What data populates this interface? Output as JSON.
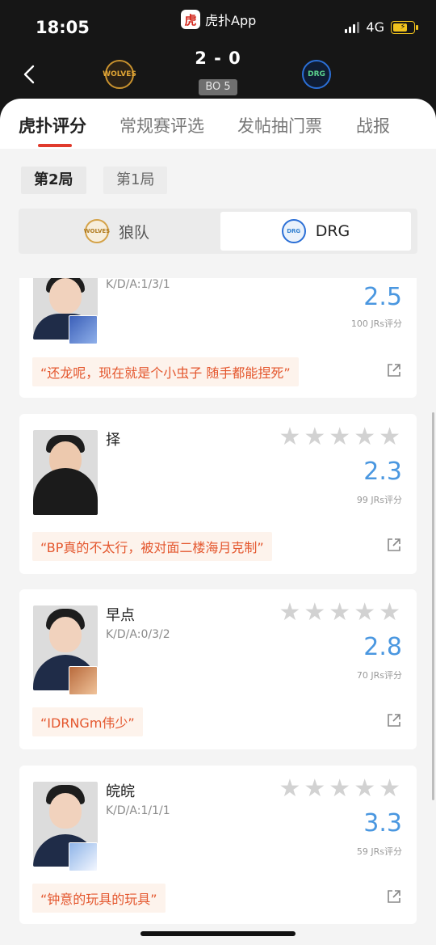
{
  "status": {
    "time": "18:05",
    "app": "虎扑App",
    "app_logo_char": "虎",
    "network": "4G"
  },
  "match": {
    "score": "2 - 0",
    "format": "BO 5",
    "team_a_short": "WOLVES",
    "team_b_short": "DRG"
  },
  "tabs": [
    {
      "label": "虎扑评分"
    },
    {
      "label": "常规赛评选"
    },
    {
      "label": "发帖抽门票"
    },
    {
      "label": "战报"
    }
  ],
  "rounds": [
    {
      "label": "第2局"
    },
    {
      "label": "第1局"
    }
  ],
  "teams": [
    {
      "label": "狼队",
      "logo_text": "WOLVES"
    },
    {
      "label": "DRG",
      "logo_text": "DRG"
    }
  ],
  "players": [
    {
      "name": "",
      "kda": "K/D/A:1/3/1",
      "score": "2.5",
      "votes": "100 JRs评分",
      "comment": "“还龙呢，现在就是个小虫子 随手都能捏死”",
      "hero_color": "#3b5fb8"
    },
    {
      "name": "择",
      "kda": "",
      "score": "2.3",
      "votes": "99 JRs评分",
      "comment": "“BP真的不太行，被对面二楼海月克制”",
      "hero_color": ""
    },
    {
      "name": "早点",
      "kda": "K/D/A:0/3/2",
      "score": "2.8",
      "votes": "70 JRs评分",
      "comment": "“IDRNGm伟少”",
      "hero_color": "#b86a3c"
    },
    {
      "name": "皖皖",
      "kda": "K/D/A:1/1/1",
      "score": "3.3",
      "votes": "59 JRs评分",
      "comment": "“钟意的玩具的玩具”",
      "hero_color": "#8fb4e8"
    }
  ],
  "colors": {
    "accent": "#e03a2c",
    "score_blue": "#4a97e0",
    "comment_orange": "#e4572e"
  }
}
